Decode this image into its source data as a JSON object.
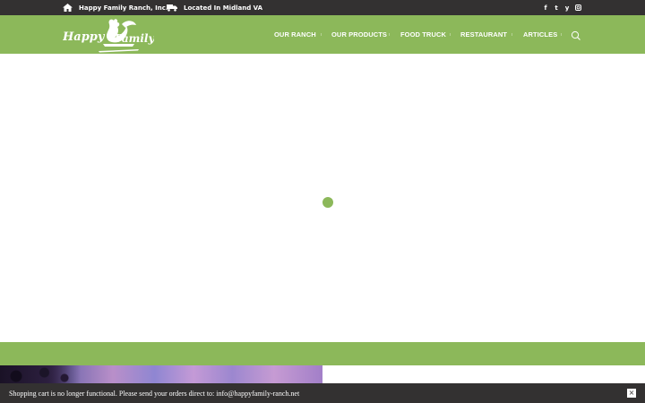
{
  "topbar": {
    "company": "Happy Family Ranch, Inc.",
    "location": "Located In Midland VA",
    "social": [
      {
        "icon": "facebook-icon",
        "glyph": "f"
      },
      {
        "icon": "twitter-icon",
        "glyph": "t"
      },
      {
        "icon": "yelp-icon",
        "glyph": "y"
      },
      {
        "icon": "instagram-icon",
        "glyph": "i"
      }
    ]
  },
  "logo": {
    "text": "Happy Family"
  },
  "nav": {
    "items": [
      "OUR RANCH",
      "OUR PRODUCTS",
      "FOOD TRUCK",
      "RESTAURANT",
      "ARTICLES"
    ]
  },
  "notice": {
    "text": "Shopping cart is no longer functional. Please send your orders direct to: info@happyfamily-ranch.net",
    "close": "×"
  },
  "colors": {
    "brand_green": "#8cb85a",
    "dark_bar": "#333131"
  }
}
